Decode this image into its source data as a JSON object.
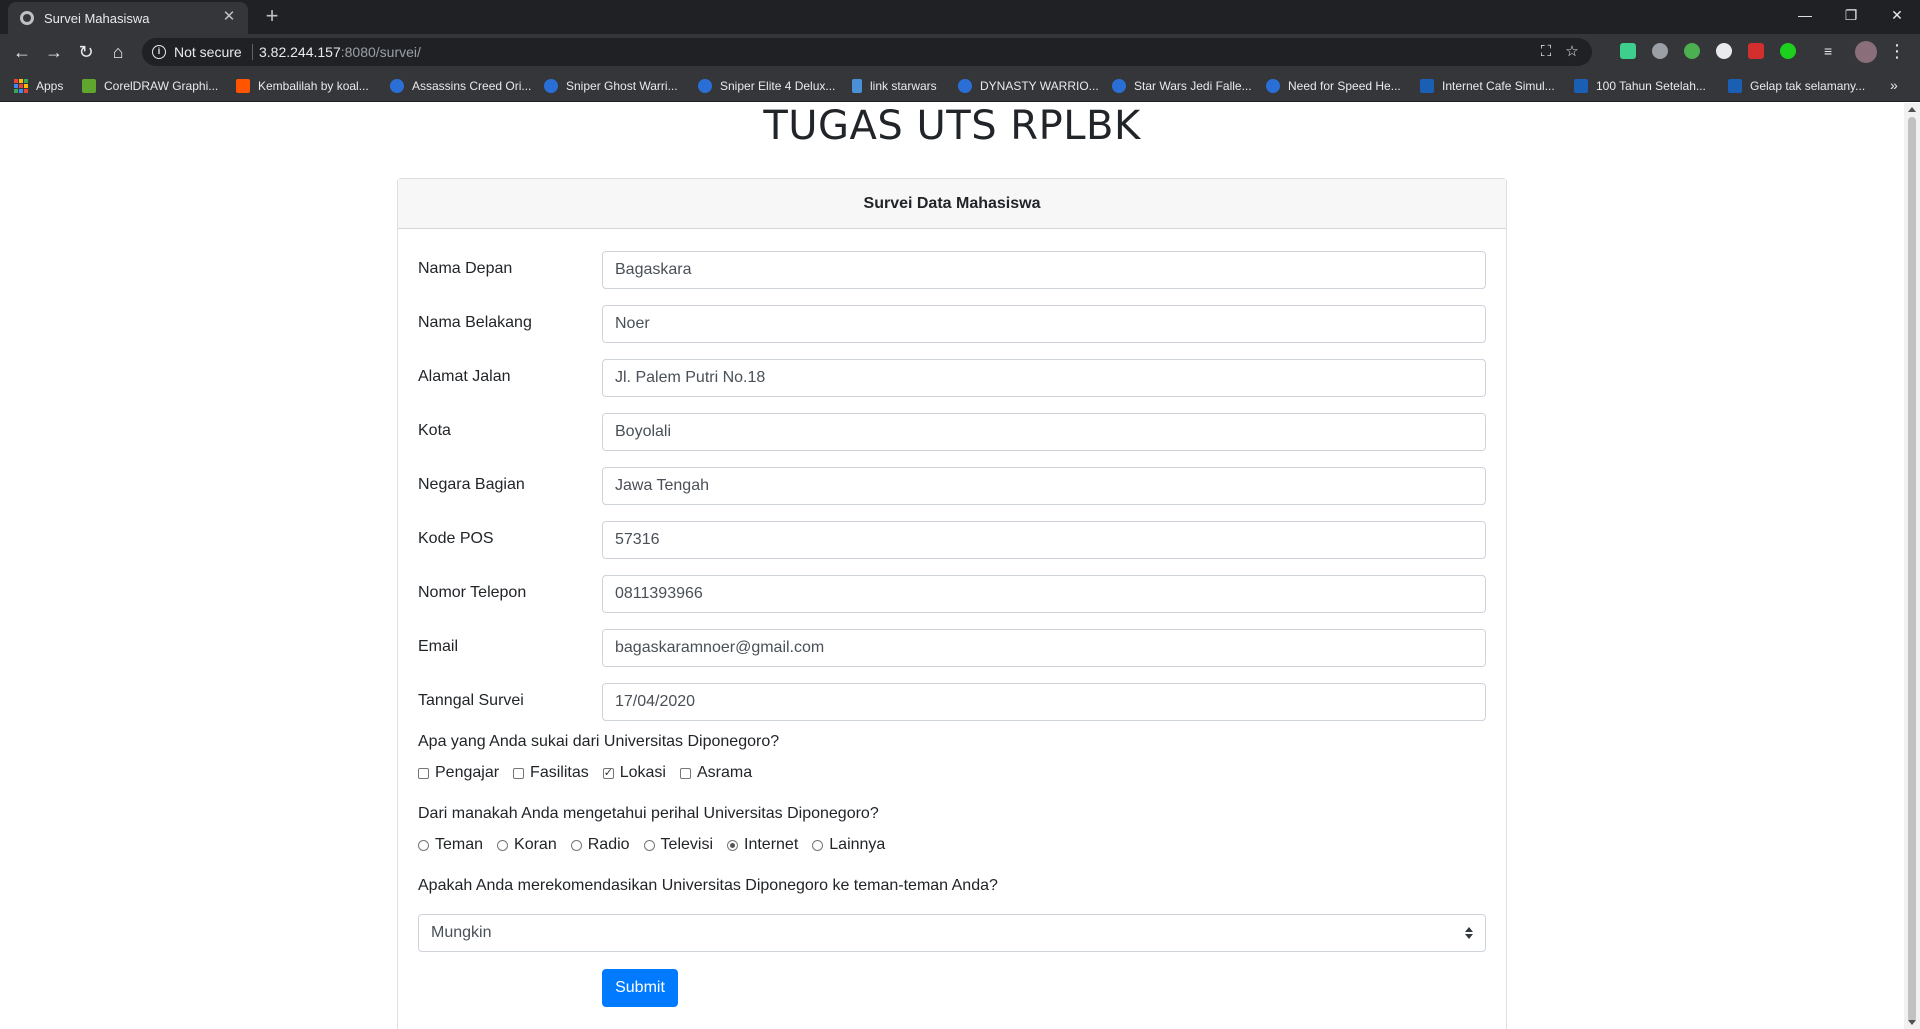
{
  "browser": {
    "tab_title": "Survei Mahasiswa",
    "tab_close": "✕",
    "new_tab": "+",
    "security_label": "Not secure",
    "url_host": "3.82.244.157",
    "url_rest": ":8080/survei/",
    "bookmarks": [
      {
        "label": "Apps",
        "icon": "apps-grid-icon"
      },
      {
        "label": "CorelDRAW Graphi...",
        "icon": "coreldraw-icon",
        "color": "#5fa52e"
      },
      {
        "label": "Kembalilah by koal...",
        "icon": "soundcloud-icon",
        "color": "#ff5500"
      },
      {
        "label": "Assassins Creed Ori...",
        "icon": "site-icon",
        "color": "#2a6fd6"
      },
      {
        "label": "Sniper Ghost Warri...",
        "icon": "site-icon",
        "color": "#2a6fd6"
      },
      {
        "label": "Sniper Elite 4 Delux...",
        "icon": "site-icon",
        "color": "#2a6fd6"
      },
      {
        "label": "link starwars",
        "icon": "link-icon",
        "color": "#4a90d9"
      },
      {
        "label": "DYNASTY WARRIO...",
        "icon": "site-icon",
        "color": "#2a6fd6"
      },
      {
        "label": "Star Wars Jedi Falle...",
        "icon": "site-icon",
        "color": "#2a6fd6"
      },
      {
        "label": "Need for Speed He...",
        "icon": "site-icon",
        "color": "#2a6fd6"
      },
      {
        "label": "Internet Cafe Simul...",
        "icon": "k-icon",
        "color": "#1a5fb4"
      },
      {
        "label": "100 Tahun Setelah...",
        "icon": "k-icon",
        "color": "#1a5fb4"
      },
      {
        "label": "Gelap tak selamany...",
        "icon": "k-icon",
        "color": "#1a5fb4"
      }
    ],
    "bookmarks_more": "»"
  },
  "page": {
    "title": "TUGAS UTS RPLBK",
    "card_title": "Survei Data Mahasiswa",
    "fields": [
      {
        "label": "Nama Depan",
        "value": "Bagaskara"
      },
      {
        "label": "Nama Belakang",
        "value": "Noer"
      },
      {
        "label": "Alamat Jalan",
        "value": "Jl. Palem Putri No.18"
      },
      {
        "label": "Kota",
        "value": "Boyolali"
      },
      {
        "label": "Negara Bagian",
        "value": "Jawa Tengah"
      },
      {
        "label": "Kode POS",
        "value": "57316"
      },
      {
        "label": "Nomor Telepon",
        "value": "0811393966"
      },
      {
        "label": "Email",
        "value": "bagaskaramnoer@gmail.com"
      },
      {
        "label": "Tanngal Survei",
        "value": "17/04/2020"
      }
    ],
    "q1": {
      "text": "Apa yang Anda sukai dari Universitas Diponegoro?",
      "options": [
        {
          "label": "Pengajar",
          "checked": false
        },
        {
          "label": "Fasilitas",
          "checked": false
        },
        {
          "label": "Lokasi",
          "checked": true
        },
        {
          "label": "Asrama",
          "checked": false
        }
      ]
    },
    "q2": {
      "text": "Dari manakah Anda mengetahui perihal Universitas Diponegoro?",
      "options": [
        {
          "label": "Teman",
          "checked": false
        },
        {
          "label": "Koran",
          "checked": false
        },
        {
          "label": "Radio",
          "checked": false
        },
        {
          "label": "Televisi",
          "checked": false
        },
        {
          "label": "Internet",
          "checked": true
        },
        {
          "label": "Lainnya",
          "checked": false
        }
      ]
    },
    "q3": {
      "text": "Apakah Anda merekomendasikan Universitas Diponegoro ke teman-teman Anda?",
      "selected": "Mungkin"
    },
    "submit_label": "Submit"
  },
  "colors": {
    "primary": "#007bff",
    "chrome_dark": "#202124",
    "chrome": "#35363a"
  }
}
